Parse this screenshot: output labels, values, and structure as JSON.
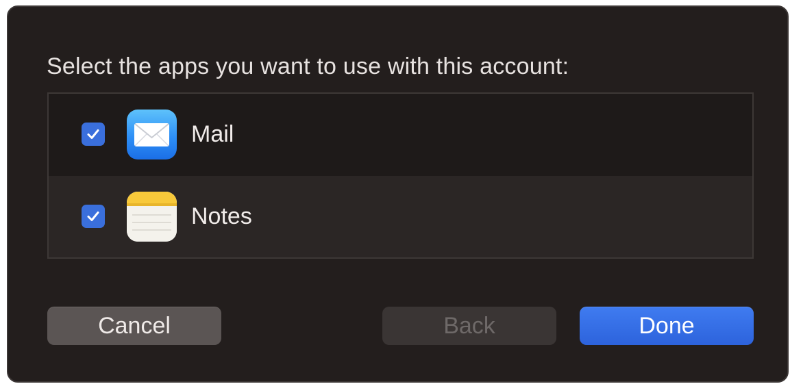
{
  "dialog": {
    "prompt": "Select the apps you want to use with this account:",
    "apps": [
      {
        "label": "Mail",
        "checked": true,
        "icon": "mail-app-icon"
      },
      {
        "label": "Notes",
        "checked": true,
        "icon": "notes-app-icon"
      }
    ],
    "buttons": {
      "cancel_label": "Cancel",
      "back_label": "Back",
      "done_label": "Done"
    },
    "colors": {
      "background": "#231e1d",
      "accent": "#3a6fdc",
      "done_button": "#2d63dc",
      "cancel_button": "#5b5554",
      "back_button_disabled": "#3a3534"
    }
  }
}
